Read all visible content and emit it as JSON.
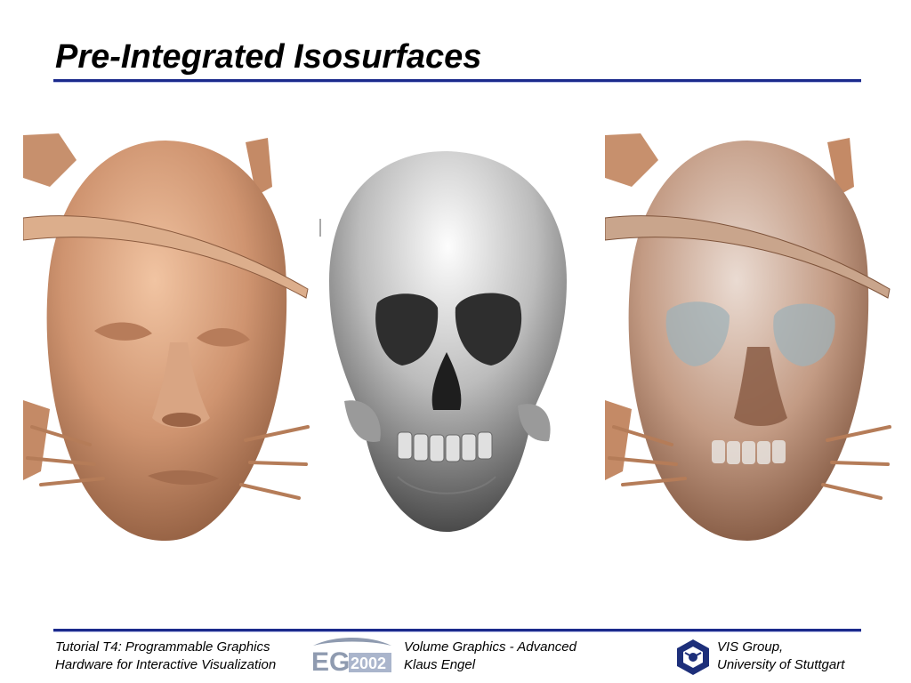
{
  "slide": {
    "title": "Pre-Integrated Isosurfaces"
  },
  "images": [
    {
      "name": "head-skin-isosurface",
      "tone": "#c98f6a"
    },
    {
      "name": "skull-bone-isosurface",
      "tone": "#b8b8b8"
    },
    {
      "name": "skin-and-bone-isosurface",
      "tone": "#c89a80"
    }
  ],
  "footer": {
    "left_line1": "Tutorial T4: Programmable Graphics",
    "left_line2": "Hardware for Interactive Visualization",
    "mid_line1": "Volume Graphics - Advanced",
    "mid_line2": "Klaus Engel",
    "right_line1": "VIS Group,",
    "right_line2": "University of Stuttgart",
    "eg_logo_text": "2002"
  },
  "colors": {
    "rule": "#1b2a8c",
    "skin": "#c98f6a",
    "bone": "#b8b8b8"
  }
}
